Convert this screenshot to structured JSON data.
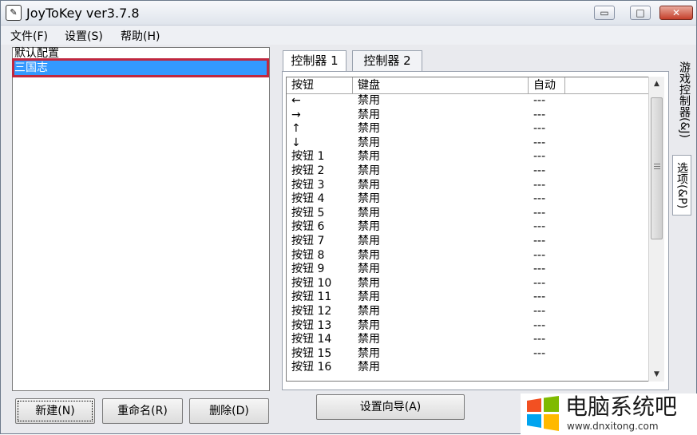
{
  "window": {
    "title": "JoyToKey ver3.7.8",
    "minimize": "▭",
    "maximize": "□",
    "close": "✕"
  },
  "menu": {
    "items": [
      "文件(F)",
      "设置(S)",
      "帮助(H)"
    ]
  },
  "profiles": {
    "items": [
      "默认配置",
      "三国志"
    ],
    "selected_index": 1
  },
  "left_buttons": {
    "new": "新建(N)",
    "rename": "重命名(R)",
    "delete": "删除(D)"
  },
  "tabs": {
    "items": [
      "控制器 1",
      "控制器 2"
    ],
    "active_index": 0
  },
  "side_tabs": {
    "game_controller": "游戏控制器(&J)",
    "options": "选项(&P)"
  },
  "table": {
    "headers": [
      "按钮",
      "键盘",
      "自动"
    ],
    "rows": [
      [
        "←",
        "禁用",
        "---"
      ],
      [
        "→",
        "禁用",
        "---"
      ],
      [
        "↑",
        "禁用",
        "---"
      ],
      [
        "↓",
        "禁用",
        "---"
      ],
      [
        "按钮 1",
        "禁用",
        "---"
      ],
      [
        "按钮 2",
        "禁用",
        "---"
      ],
      [
        "按钮 3",
        "禁用",
        "---"
      ],
      [
        "按钮 4",
        "禁用",
        "---"
      ],
      [
        "按钮 5",
        "禁用",
        "---"
      ],
      [
        "按钮 6",
        "禁用",
        "---"
      ],
      [
        "按钮 7",
        "禁用",
        "---"
      ],
      [
        "按钮 8",
        "禁用",
        "---"
      ],
      [
        "按钮 9",
        "禁用",
        "---"
      ],
      [
        "按钮 10",
        "禁用",
        "---"
      ],
      [
        "按钮 11",
        "禁用",
        "---"
      ],
      [
        "按钮 12",
        "禁用",
        "---"
      ],
      [
        "按钮 13",
        "禁用",
        "---"
      ],
      [
        "按钮 14",
        "禁用",
        "---"
      ],
      [
        "按钮 15",
        "禁用",
        "---"
      ],
      [
        "按钮 16",
        "禁用",
        ""
      ]
    ]
  },
  "wizard_button": "设置向导(A)",
  "watermark": {
    "title": "电脑系统吧",
    "url": "www.dnxitong.com"
  },
  "colors": {
    "selection": "#3399ff",
    "highlight_border": "#c0283f",
    "close_button": "#c5402b"
  }
}
